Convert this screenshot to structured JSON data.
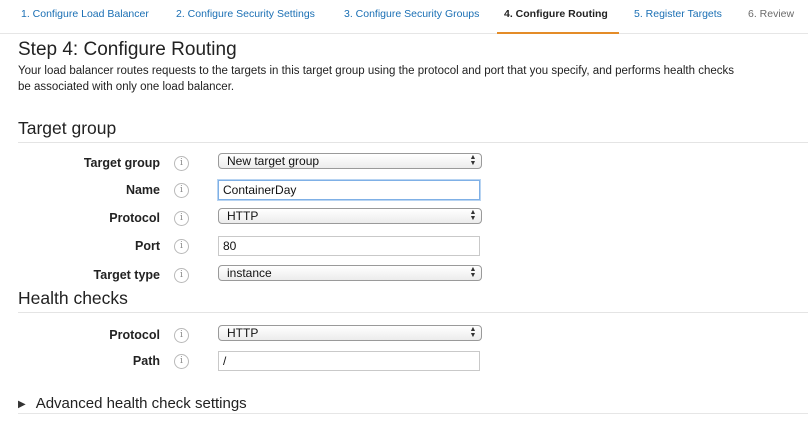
{
  "steps": [
    {
      "label": "1. Configure Load Balancer"
    },
    {
      "label": "2. Configure Security Settings"
    },
    {
      "label": "3. Configure Security Groups"
    },
    {
      "label": "4. Configure Routing"
    },
    {
      "label": "5. Register Targets"
    },
    {
      "label": "6. Review"
    }
  ],
  "active_step_index": 3,
  "page": {
    "title": "Step 4: Configure Routing",
    "intro_line1": "Your load balancer routes requests to the targets in this target group using the protocol and port that you specify, and performs health checks",
    "intro_line2": "be associated with only one load balancer."
  },
  "target_group_section": {
    "title": "Target group",
    "fields": {
      "target_group": {
        "label": "Target group",
        "value": "New target group"
      },
      "name": {
        "label": "Name",
        "value": "ContainerDay"
      },
      "protocol": {
        "label": "Protocol",
        "value": "HTTP"
      },
      "port": {
        "label": "Port",
        "value": "80"
      },
      "target_type": {
        "label": "Target type",
        "value": "instance"
      }
    }
  },
  "health_checks_section": {
    "title": "Health checks",
    "fields": {
      "protocol": {
        "label": "Protocol",
        "value": "HTTP"
      },
      "path": {
        "label": "Path",
        "value": "/"
      }
    }
  },
  "advanced": {
    "label": "Advanced health check settings"
  },
  "icons": {
    "info": "i",
    "select_arrows": "▲▼",
    "caret": "▶"
  },
  "colors": {
    "link": "#1a6fb4",
    "active_underline": "#e48c28",
    "text": "#222222"
  }
}
